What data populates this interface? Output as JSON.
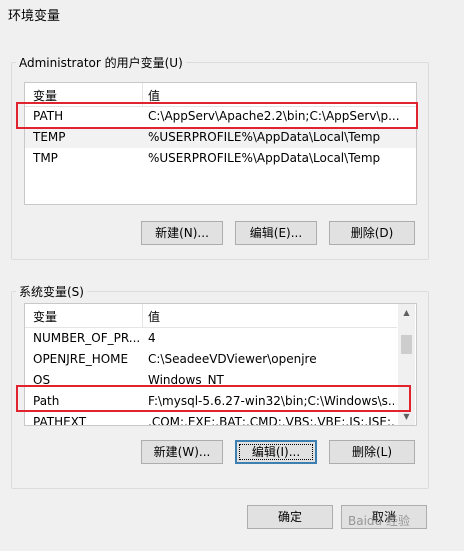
{
  "window": {
    "title": "环境变量"
  },
  "user_group": {
    "label": "Administrator 的用户变量(U)",
    "columns": [
      "变量",
      "值"
    ],
    "rows": [
      {
        "name": "PATH",
        "value": "C:\\AppServ\\Apache2.2\\bin;C:\\AppServ\\p..."
      },
      {
        "name": "TEMP",
        "value": "%USERPROFILE%\\AppData\\Local\\Temp"
      },
      {
        "name": "TMP",
        "value": "%USERPROFILE%\\AppData\\Local\\Temp"
      }
    ],
    "buttons": {
      "new": "新建(N)...",
      "edit": "编辑(E)...",
      "delete": "删除(D)"
    }
  },
  "system_group": {
    "label": "系统变量(S)",
    "columns": [
      "变量",
      "值"
    ],
    "rows": [
      {
        "name": "NUMBER_OF_PR...",
        "value": "4"
      },
      {
        "name": "OPENJRE_HOME",
        "value": "C:\\SeadeeVDViewer\\openjre"
      },
      {
        "name": "OS",
        "value": "Windows_NT"
      },
      {
        "name": "Path",
        "value": "F:\\mysql-5.6.27-win32\\bin;C:\\Windows\\s..."
      },
      {
        "name": "PATHEXT",
        "value": ".COM;.EXE;.BAT;.CMD;.VBS;.VBE;.JS;.JSE;..."
      }
    ],
    "buttons": {
      "new": "新建(W)...",
      "edit": "编辑(I)...",
      "delete": "删除(L)"
    }
  },
  "footer": {
    "ok": "确定",
    "cancel": "取消"
  },
  "watermark": "Baidu 经验",
  "colors": {
    "highlight": "#e0232e",
    "focus": "#3c7fb1"
  }
}
